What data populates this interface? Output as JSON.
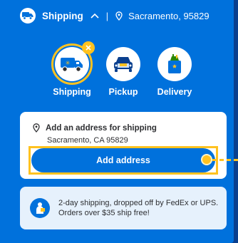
{
  "header": {
    "title": "Shipping",
    "separator": "|",
    "location": "Sacramento, 95829"
  },
  "options": [
    {
      "label": "Shipping",
      "icon": "shipping-truck-icon",
      "selected": true
    },
    {
      "label": "Pickup",
      "icon": "pickup-car-icon",
      "selected": false
    },
    {
      "label": "Delivery",
      "icon": "delivery-bag-icon",
      "selected": false
    }
  ],
  "address_card": {
    "heading": "Add an address for shipping",
    "subtext": "Sacramento, CA 95829",
    "button_label": "Add address"
  },
  "info": {
    "line1": "2-day shipping, dropped off by FedEx or UPS.",
    "line2": "Orders over $35 ship free!"
  },
  "colors": {
    "brand_blue": "#0071dc",
    "accent_yellow": "#ffc220",
    "info_bg": "#e6f1fc"
  }
}
